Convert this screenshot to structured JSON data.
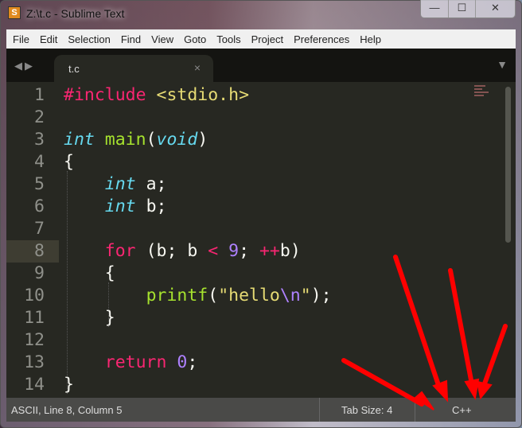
{
  "window": {
    "title": "Z:\\t.c - Sublime Text",
    "icon_letter": "S",
    "minimize": "—",
    "maximize": "☐",
    "close": "✕"
  },
  "menu": [
    "File",
    "Edit",
    "Selection",
    "Find",
    "View",
    "Goto",
    "Tools",
    "Project",
    "Preferences",
    "Help"
  ],
  "tabs": [
    {
      "label": "t.c",
      "close": "×"
    }
  ],
  "nav": {
    "back": "◀",
    "forward": "▶",
    "tab_menu": "▼"
  },
  "editor": {
    "current_line": 8,
    "lines": [
      {
        "n": "1",
        "tokens": [
          [
            "kw",
            "#include"
          ],
          [
            "pl",
            " "
          ],
          [
            "str",
            "<stdio.h>"
          ]
        ]
      },
      {
        "n": "2",
        "tokens": []
      },
      {
        "n": "3",
        "tokens": [
          [
            "ty",
            "int"
          ],
          [
            "pl",
            " "
          ],
          [
            "fn",
            "main"
          ],
          [
            "pl",
            "("
          ],
          [
            "ty",
            "void"
          ],
          [
            "pl",
            ")"
          ]
        ]
      },
      {
        "n": "4",
        "tokens": [
          [
            "pl",
            "{"
          ]
        ]
      },
      {
        "n": "5",
        "tokens": [
          [
            "pl",
            "    "
          ],
          [
            "ty",
            "int"
          ],
          [
            "pl",
            " a;"
          ]
        ]
      },
      {
        "n": "6",
        "tokens": [
          [
            "pl",
            "    "
          ],
          [
            "ty",
            "int"
          ],
          [
            "pl",
            " b;"
          ]
        ]
      },
      {
        "n": "7",
        "tokens": []
      },
      {
        "n": "8",
        "tokens": [
          [
            "pl",
            "    "
          ],
          [
            "kw",
            "for"
          ],
          [
            "pl",
            " (b; b "
          ],
          [
            "kw",
            "<"
          ],
          [
            "pl",
            " "
          ],
          [
            "num",
            "9"
          ],
          [
            "pl",
            "; "
          ],
          [
            "kw",
            "++"
          ],
          [
            "pl",
            "b)"
          ]
        ]
      },
      {
        "n": "9",
        "tokens": [
          [
            "pl",
            "    {"
          ]
        ]
      },
      {
        "n": "10",
        "tokens": [
          [
            "pl",
            "        "
          ],
          [
            "fn",
            "printf"
          ],
          [
            "pl",
            "("
          ],
          [
            "str",
            "\"hello"
          ],
          [
            "esc",
            "\\n"
          ],
          [
            "str",
            "\""
          ],
          [
            "pl",
            ");"
          ]
        ]
      },
      {
        "n": "11",
        "tokens": [
          [
            "pl",
            "    }"
          ]
        ]
      },
      {
        "n": "12",
        "tokens": []
      },
      {
        "n": "13",
        "tokens": [
          [
            "pl",
            "    "
          ],
          [
            "kw",
            "return"
          ],
          [
            "pl",
            " "
          ],
          [
            "num",
            "0"
          ],
          [
            "pl",
            ";"
          ]
        ]
      },
      {
        "n": "14",
        "tokens": [
          [
            "pl",
            "}"
          ]
        ]
      }
    ]
  },
  "status": {
    "position": "ASCII, Line 8, Column 5",
    "tab_size": "Tab Size: 4",
    "syntax": "C++"
  }
}
